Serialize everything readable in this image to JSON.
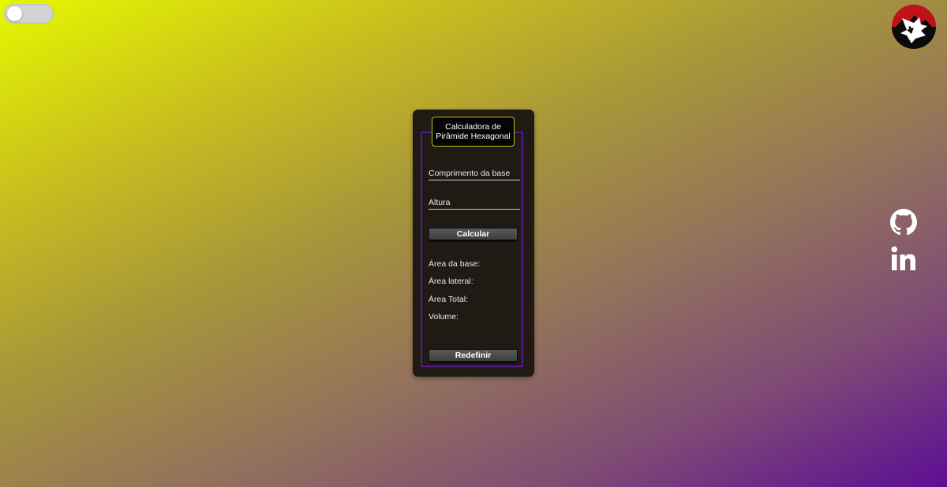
{
  "calculator": {
    "title": "Calculadora de Pirâmide Hexagonal",
    "base_placeholder": "Comprimento da base",
    "height_placeholder": "Altura",
    "calculate_label": "Calcular",
    "reset_label": "Redefinir",
    "results": {
      "base_area": "Área da base:",
      "lateral_area": "Área lateral:",
      "total_area": "Área Total:",
      "volume": "Volume:"
    }
  },
  "theme_toggle": {
    "state": "off"
  },
  "icons": {
    "logo": "wolf-logo-icon",
    "github": "github-icon",
    "linkedin": "linkedin-icon"
  },
  "colors": {
    "background_start": "#e5f700",
    "background_end": "#5d0e94",
    "card": "#1f1a13",
    "frame_border": "#5a1a8f",
    "title_border": "#b8c21a",
    "logo_red": "#c1121a"
  }
}
